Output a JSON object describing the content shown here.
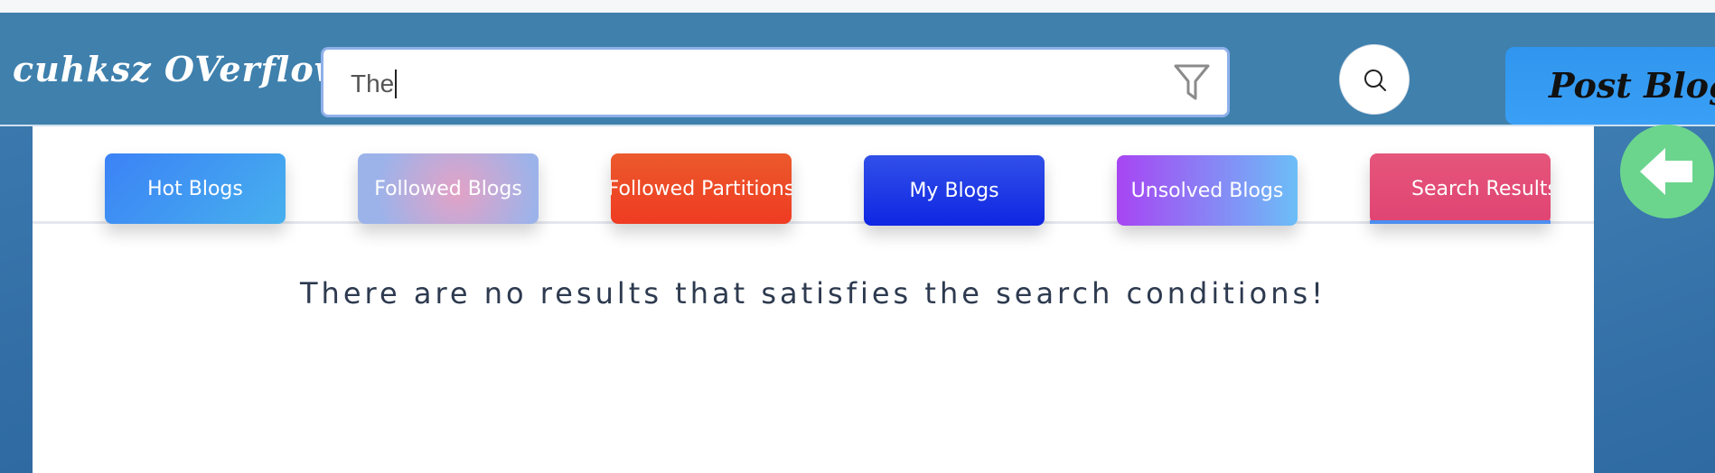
{
  "header": {
    "logo": "cuhksz OVerflow",
    "search": {
      "value": "The",
      "filter_icon": "filter-icon"
    },
    "search_button_icon": "search-icon",
    "post_button": "Post Blog"
  },
  "tabs": [
    {
      "label": "Hot Blogs"
    },
    {
      "label": "Followed Blogs"
    },
    {
      "label": "Followed Partitions"
    },
    {
      "label": "My Blogs"
    },
    {
      "label": "Unsolved Blogs"
    },
    {
      "label": "Search Results",
      "active": true
    }
  ],
  "back_button_icon": "arrow-left-icon",
  "message": "There are no results that satisfies the search conditions!",
  "colors": {
    "header": "#3f80ad",
    "back_button": "#6bd58d",
    "active_tab_indicator": "#4d8ef0"
  }
}
